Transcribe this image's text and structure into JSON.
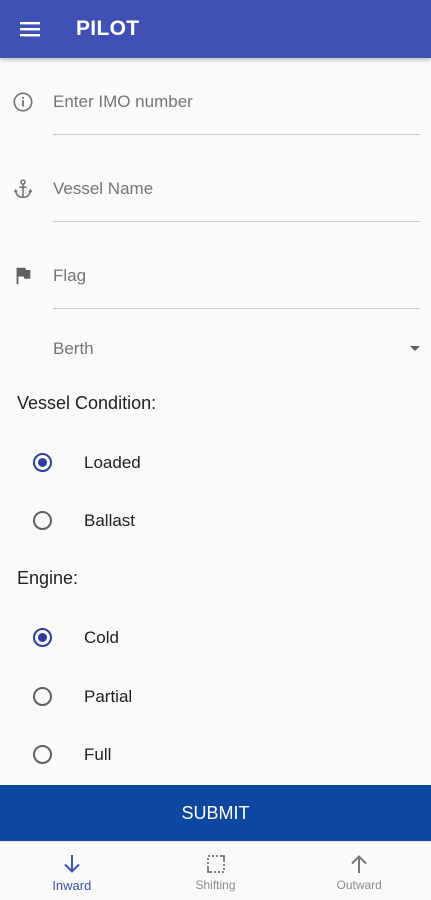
{
  "app_bar": {
    "title": "PILOT",
    "menu_icon": "menu-icon",
    "color": "#3f51b5"
  },
  "form": {
    "imo": {
      "placeholder": "Enter IMO number",
      "icon": "info-icon"
    },
    "vessel_name": {
      "placeholder": "Vessel Name",
      "icon": "anchor-icon"
    },
    "flag": {
      "placeholder": "Flag",
      "icon": "flag-icon"
    },
    "berth": {
      "value": "Berth",
      "icon": "dropdown-caret-icon"
    },
    "vessel_condition": {
      "label": "Vessel Condition:",
      "options": [
        {
          "label": "Loaded",
          "checked": true
        },
        {
          "label": "Ballast",
          "checked": false
        }
      ]
    },
    "engine": {
      "label": "Engine:",
      "options": [
        {
          "label": "Cold",
          "checked": true
        },
        {
          "label": "Partial",
          "checked": false
        },
        {
          "label": "Full",
          "checked": false
        }
      ]
    },
    "submit_label": "SUBMIT",
    "submit_color": "#0d47a1"
  },
  "bottom_nav": {
    "items": [
      {
        "label": "Inward",
        "icon": "arrow-down-icon",
        "active": true
      },
      {
        "label": "Shifting",
        "icon": "shifting-icon",
        "active": false
      },
      {
        "label": "Outward",
        "icon": "arrow-up-icon",
        "active": false
      }
    ]
  }
}
